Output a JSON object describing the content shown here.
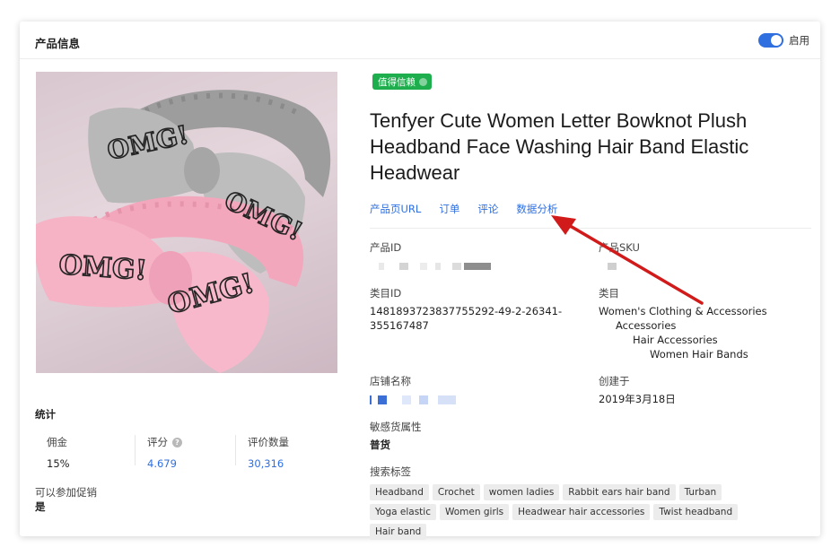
{
  "header": {
    "title": "产品信息",
    "toggle_label": "启用",
    "toggle_on": true,
    "accent_color": "#2f6fe0"
  },
  "product": {
    "badge": "值得信赖",
    "title": "Tenfyer Cute Women Letter Bowknot Plush Headband Face Washing Hair Band Elastic Headwear",
    "image_text_top": "OMG!",
    "image_text_bottom": "OMG!"
  },
  "tabs": [
    "产品页URL",
    "订单",
    "评论",
    "数据分析"
  ],
  "fields": {
    "product_id_label": "产品ID",
    "product_sku_label": "产品SKU",
    "category_id_label": "类目ID",
    "category_id_value": "1481893723837755292-49-2-26341-355167487",
    "category_label": "类目",
    "category_path": [
      "Women's Clothing & Accessories",
      "Accessories",
      "Hair Accessories",
      "Women Hair Bands"
    ],
    "store_label": "店铺名称",
    "created_label": "创建于",
    "created_value": "2019年3月18日",
    "sensitive_label": "敏感货属性",
    "sensitive_value": "普货",
    "search_tags_label": "搜索标签"
  },
  "search_tags": [
    "Headband",
    "Crochet",
    "women ladies",
    "Rabbit ears hair band",
    "Turban",
    "Yoga elastic",
    "Women girls",
    "Headwear hair accessories",
    "Twist headband",
    "Hair band"
  ],
  "stats": {
    "title": "统计",
    "commission_label": "佣金",
    "commission_value": "15%",
    "rating_label": "评分",
    "rating_value": "4.679",
    "reviews_label": "评价数量",
    "reviews_value": "30,316",
    "promo_label": "可以参加促销",
    "promo_value": "是"
  },
  "colors": {
    "link": "#2f6fe0",
    "badge": "#1fae4e",
    "arrow": "#d11a1a"
  }
}
